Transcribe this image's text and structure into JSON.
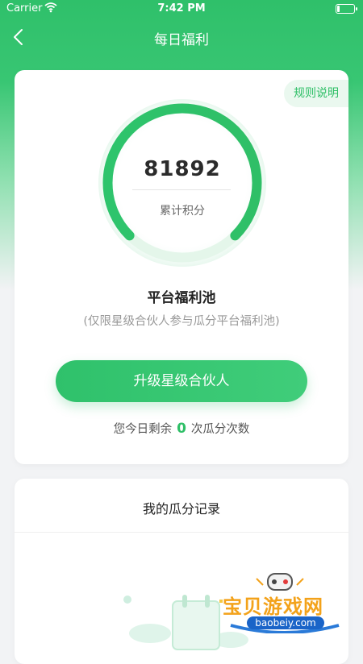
{
  "status_bar": {
    "carrier": "Carrier",
    "time": "7:42 PM"
  },
  "nav": {
    "title": "每日福利"
  },
  "rules_button": "规则说明",
  "points": {
    "value": "81892",
    "label": "累计积分"
  },
  "pool": {
    "title": "平台福利池",
    "subtitle": "(仅限星级合伙人参与瓜分平台福利池)"
  },
  "upgrade_button": "升级星级合伙人",
  "remaining": {
    "prefix": "您今日剩余",
    "count": "0",
    "suffix": "次瓜分次数"
  },
  "records": {
    "title": "我的瓜分记录"
  },
  "watermark": {
    "title": "宝贝游戏网",
    "url": "baobeiy.com"
  },
  "colors": {
    "primary": "#2fbf67",
    "accent": "#f3a21a"
  }
}
